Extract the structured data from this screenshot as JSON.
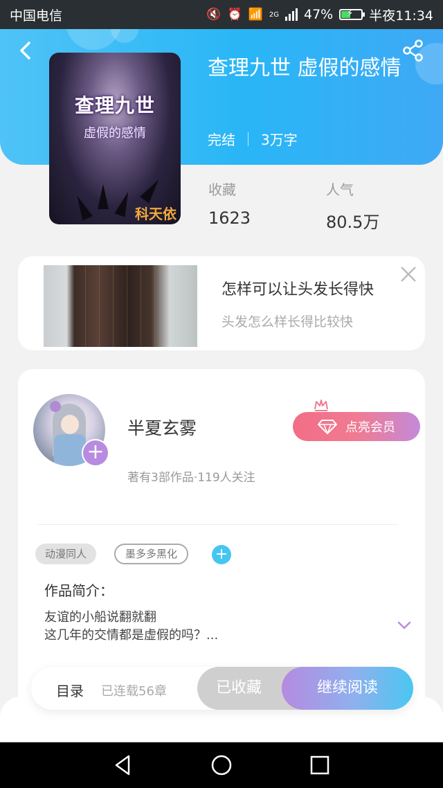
{
  "status_bar": {
    "carrier": "中国电信",
    "network": "2G",
    "battery": "47%",
    "battery_level": 0.47,
    "time": "半夜11:34"
  },
  "header": {
    "back_icon": "back-arrow-icon",
    "share_icon": "share-icon"
  },
  "book": {
    "cover_title": "查理九世",
    "cover_subtitle": "虚假的感情",
    "cover_author": "科天依",
    "title": "查理九世 虚假的感情",
    "status": "完结",
    "word_count": "3万字",
    "stats": [
      {
        "label": "收藏",
        "value": "1623"
      },
      {
        "label": "人气",
        "value": "80.5万"
      }
    ]
  },
  "ad": {
    "title": "怎样可以让头发长得快",
    "subtitle": "头发怎么样长得比较快",
    "close_icon": "close-icon"
  },
  "author": {
    "name": "半夏玄雾",
    "info": "著有3部作品·119人关注",
    "follow_label": "+",
    "vip_label": "点亮会员",
    "vip_icon": "diamond-icon",
    "crown_icon": "crown-icon"
  },
  "tags": [
    "动漫同人",
    "墨多多黑化"
  ],
  "add_tag_label": "+",
  "intro": {
    "label": "作品简介：",
    "text": "友谊的小船说翻就翻\n这几年的交情都是虚假的吗？..."
  },
  "action_bar": {
    "toc": "目录",
    "chapters": "已连载56章",
    "collected": "已收藏",
    "read": "继续阅读"
  },
  "colors": {
    "header_blue": "#29b6f6",
    "accent_purple": "#b98be0",
    "vip_pink": "#f26d86",
    "tag_add_blue": "#45c6f0"
  }
}
